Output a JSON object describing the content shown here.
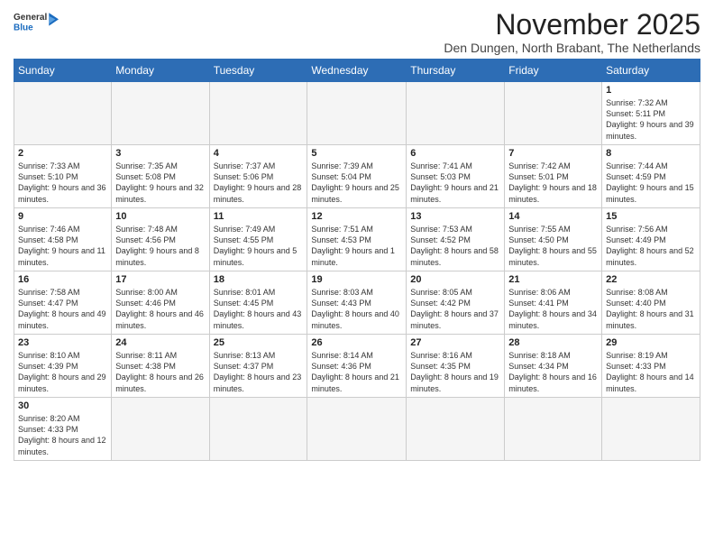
{
  "logo": {
    "text_general": "General",
    "text_blue": "Blue"
  },
  "header": {
    "month": "November 2025",
    "location": "Den Dungen, North Brabant, The Netherlands"
  },
  "weekdays": [
    "Sunday",
    "Monday",
    "Tuesday",
    "Wednesday",
    "Thursday",
    "Friday",
    "Saturday"
  ],
  "weeks": [
    [
      {
        "day": "",
        "info": ""
      },
      {
        "day": "",
        "info": ""
      },
      {
        "day": "",
        "info": ""
      },
      {
        "day": "",
        "info": ""
      },
      {
        "day": "",
        "info": ""
      },
      {
        "day": "",
        "info": ""
      },
      {
        "day": "1",
        "info": "Sunrise: 7:32 AM\nSunset: 5:11 PM\nDaylight: 9 hours and 39 minutes."
      }
    ],
    [
      {
        "day": "2",
        "info": "Sunrise: 7:33 AM\nSunset: 5:10 PM\nDaylight: 9 hours and 36 minutes."
      },
      {
        "day": "3",
        "info": "Sunrise: 7:35 AM\nSunset: 5:08 PM\nDaylight: 9 hours and 32 minutes."
      },
      {
        "day": "4",
        "info": "Sunrise: 7:37 AM\nSunset: 5:06 PM\nDaylight: 9 hours and 28 minutes."
      },
      {
        "day": "5",
        "info": "Sunrise: 7:39 AM\nSunset: 5:04 PM\nDaylight: 9 hours and 25 minutes."
      },
      {
        "day": "6",
        "info": "Sunrise: 7:41 AM\nSunset: 5:03 PM\nDaylight: 9 hours and 21 minutes."
      },
      {
        "day": "7",
        "info": "Sunrise: 7:42 AM\nSunset: 5:01 PM\nDaylight: 9 hours and 18 minutes."
      },
      {
        "day": "8",
        "info": "Sunrise: 7:44 AM\nSunset: 4:59 PM\nDaylight: 9 hours and 15 minutes."
      }
    ],
    [
      {
        "day": "9",
        "info": "Sunrise: 7:46 AM\nSunset: 4:58 PM\nDaylight: 9 hours and 11 minutes."
      },
      {
        "day": "10",
        "info": "Sunrise: 7:48 AM\nSunset: 4:56 PM\nDaylight: 9 hours and 8 minutes."
      },
      {
        "day": "11",
        "info": "Sunrise: 7:49 AM\nSunset: 4:55 PM\nDaylight: 9 hours and 5 minutes."
      },
      {
        "day": "12",
        "info": "Sunrise: 7:51 AM\nSunset: 4:53 PM\nDaylight: 9 hours and 1 minute."
      },
      {
        "day": "13",
        "info": "Sunrise: 7:53 AM\nSunset: 4:52 PM\nDaylight: 8 hours and 58 minutes."
      },
      {
        "day": "14",
        "info": "Sunrise: 7:55 AM\nSunset: 4:50 PM\nDaylight: 8 hours and 55 minutes."
      },
      {
        "day": "15",
        "info": "Sunrise: 7:56 AM\nSunset: 4:49 PM\nDaylight: 8 hours and 52 minutes."
      }
    ],
    [
      {
        "day": "16",
        "info": "Sunrise: 7:58 AM\nSunset: 4:47 PM\nDaylight: 8 hours and 49 minutes."
      },
      {
        "day": "17",
        "info": "Sunrise: 8:00 AM\nSunset: 4:46 PM\nDaylight: 8 hours and 46 minutes."
      },
      {
        "day": "18",
        "info": "Sunrise: 8:01 AM\nSunset: 4:45 PM\nDaylight: 8 hours and 43 minutes."
      },
      {
        "day": "19",
        "info": "Sunrise: 8:03 AM\nSunset: 4:43 PM\nDaylight: 8 hours and 40 minutes."
      },
      {
        "day": "20",
        "info": "Sunrise: 8:05 AM\nSunset: 4:42 PM\nDaylight: 8 hours and 37 minutes."
      },
      {
        "day": "21",
        "info": "Sunrise: 8:06 AM\nSunset: 4:41 PM\nDaylight: 8 hours and 34 minutes."
      },
      {
        "day": "22",
        "info": "Sunrise: 8:08 AM\nSunset: 4:40 PM\nDaylight: 8 hours and 31 minutes."
      }
    ],
    [
      {
        "day": "23",
        "info": "Sunrise: 8:10 AM\nSunset: 4:39 PM\nDaylight: 8 hours and 29 minutes."
      },
      {
        "day": "24",
        "info": "Sunrise: 8:11 AM\nSunset: 4:38 PM\nDaylight: 8 hours and 26 minutes."
      },
      {
        "day": "25",
        "info": "Sunrise: 8:13 AM\nSunset: 4:37 PM\nDaylight: 8 hours and 23 minutes."
      },
      {
        "day": "26",
        "info": "Sunrise: 8:14 AM\nSunset: 4:36 PM\nDaylight: 8 hours and 21 minutes."
      },
      {
        "day": "27",
        "info": "Sunrise: 8:16 AM\nSunset: 4:35 PM\nDaylight: 8 hours and 19 minutes."
      },
      {
        "day": "28",
        "info": "Sunrise: 8:18 AM\nSunset: 4:34 PM\nDaylight: 8 hours and 16 minutes."
      },
      {
        "day": "29",
        "info": "Sunrise: 8:19 AM\nSunset: 4:33 PM\nDaylight: 8 hours and 14 minutes."
      }
    ],
    [
      {
        "day": "30",
        "info": "Sunrise: 8:20 AM\nSunset: 4:33 PM\nDaylight: 8 hours and 12 minutes."
      },
      {
        "day": "",
        "info": ""
      },
      {
        "day": "",
        "info": ""
      },
      {
        "day": "",
        "info": ""
      },
      {
        "day": "",
        "info": ""
      },
      {
        "day": "",
        "info": ""
      },
      {
        "day": "",
        "info": ""
      }
    ]
  ]
}
